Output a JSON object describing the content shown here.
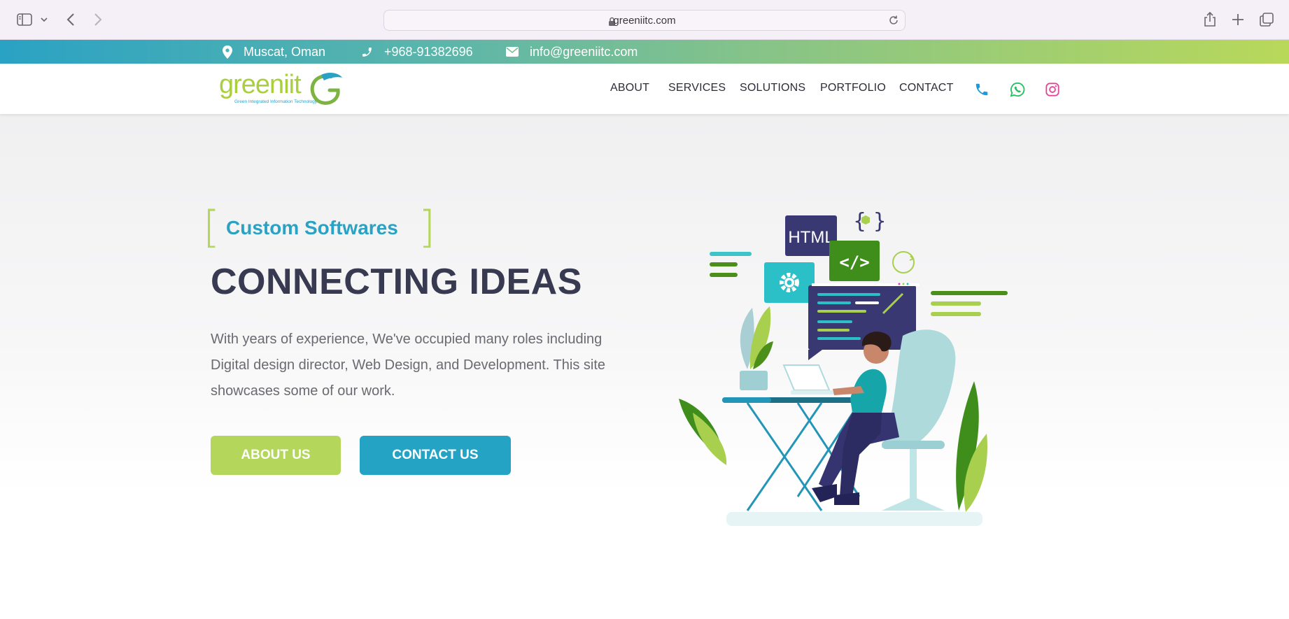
{
  "browser": {
    "url": "greeniitc.com"
  },
  "topbar": {
    "location": "Muscat, Oman",
    "phone": "+968-91382696",
    "email": "info@greeniitc.com"
  },
  "logo": {
    "wordmark": "greeniit",
    "tagline": "Green Integrated Information Technology"
  },
  "nav": {
    "items": [
      {
        "label": "ABOUT"
      },
      {
        "label": "SERVICES"
      },
      {
        "label": "SOLUTIONS"
      },
      {
        "label": "PORTFOLIO"
      },
      {
        "label": "CONTACT"
      }
    ],
    "icons": [
      "phone-icon",
      "whatsapp-icon",
      "instagram-icon"
    ]
  },
  "hero": {
    "tagline": "Custom Softwares",
    "headline": "CONNECTING IDEAS",
    "description": "With years of experience, We've occupied many roles including Digital design director, Web Design, and Development. This site showcases some of our work.",
    "buttons": {
      "about": "ABOUT US",
      "contact": "CONTACT US"
    },
    "illustration": {
      "html_label": "HTML",
      "code_label": "</>",
      "braces_label": "{ }"
    }
  },
  "colors": {
    "brand_green": "#b3d65b",
    "brand_blue": "#25a3c5",
    "headline": "#373a50",
    "navy": "#3a3873"
  }
}
